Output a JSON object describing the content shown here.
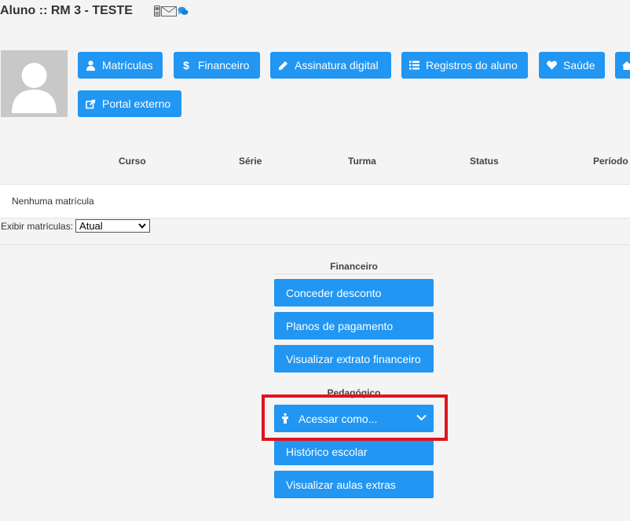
{
  "page": {
    "title": "Aluno :: RM 3 - TESTE"
  },
  "title_icons": [
    "phone-icon",
    "envelope-icon",
    "chat-icon"
  ],
  "toolbar": {
    "matriculas": "Matrículas",
    "financeiro": "Financeiro",
    "assinatura": "Assinatura digital",
    "registros": "Registros do aluno",
    "saude": "Saúde",
    "portal": "Portal externo"
  },
  "table": {
    "headers": [
      "Curso",
      "Série",
      "Turma",
      "Status",
      "Período"
    ],
    "empty_message": "Nenhuma matrícula"
  },
  "filter": {
    "label": "Exibir matrículas:",
    "selected": "Atual"
  },
  "financeiro_section": {
    "title": "Financeiro",
    "buttons": [
      "Conceder desconto",
      "Planos de pagamento",
      "Visualizar extrato financeiro"
    ]
  },
  "pedagogico_section": {
    "title": "Pedagógico",
    "access_as": "Acessar como...",
    "buttons": [
      "Histórico escolar",
      "Visualizar aulas extras"
    ]
  },
  "colors": {
    "primary": "#2196f3",
    "highlight": "#e0141e",
    "background": "#f4f4f4"
  }
}
